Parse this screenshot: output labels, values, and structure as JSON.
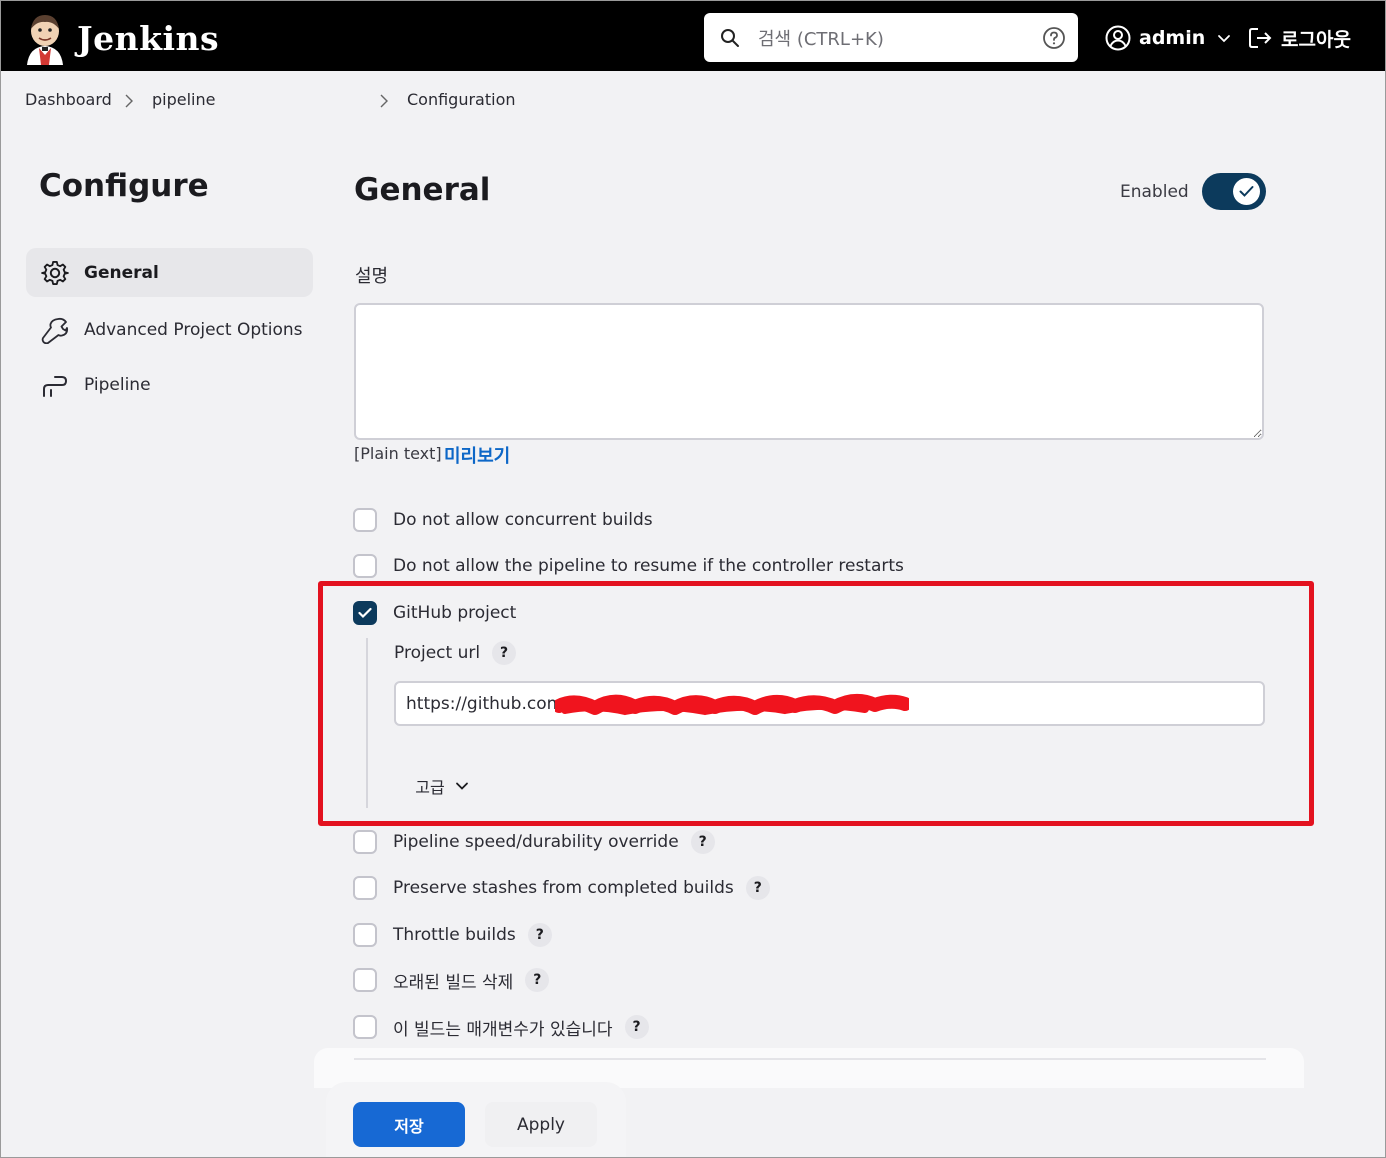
{
  "header": {
    "brand": "Jenkins",
    "search_placeholder": "검색 (CTRL+K)",
    "user_name": "admin",
    "logout_label": "로그아웃"
  },
  "breadcrumb": {
    "items": [
      "Dashboard",
      "pipeline",
      "Configuration"
    ]
  },
  "sidebar": {
    "title": "Configure",
    "items": [
      {
        "label": "General",
        "icon": "gear-icon",
        "active": true
      },
      {
        "label": "Advanced Project Options",
        "icon": "wrench-icon",
        "active": false
      },
      {
        "label": "Pipeline",
        "icon": "pipeline-icon",
        "active": false
      }
    ]
  },
  "main": {
    "title": "General",
    "enabled_label": "Enabled",
    "enabled": true,
    "description_label": "설명",
    "description_value": "",
    "plain_text_label": "[Plain text]",
    "preview_label": "미리보기",
    "options": [
      {
        "label": "Do not allow concurrent builds",
        "checked": false,
        "help": false
      },
      {
        "label": "Do not allow the pipeline to resume if the controller restarts",
        "checked": false,
        "help": false
      },
      {
        "label": "GitHub project",
        "checked": true,
        "help": false
      },
      {
        "label": "Pipeline speed/durability override",
        "checked": false,
        "help": true
      },
      {
        "label": "Preserve stashes from completed builds",
        "checked": false,
        "help": true
      },
      {
        "label": "Throttle builds",
        "checked": false,
        "help": true
      },
      {
        "label": "오래된 빌드 삭제",
        "checked": false,
        "help": true
      },
      {
        "label": "이 빌드는 매개변수가 있습니다",
        "checked": false,
        "help": true
      }
    ],
    "github": {
      "project_url_label": "Project url",
      "project_url_value": "https://github.com/",
      "advanced_label": "고급"
    },
    "help_glyph": "?"
  },
  "buttons": {
    "save": "저장",
    "apply": "Apply"
  },
  "colors": {
    "accent": "#0c3a5c",
    "primary_button": "#1769d4",
    "link": "#0d67c7",
    "highlight": "#e3121f"
  }
}
